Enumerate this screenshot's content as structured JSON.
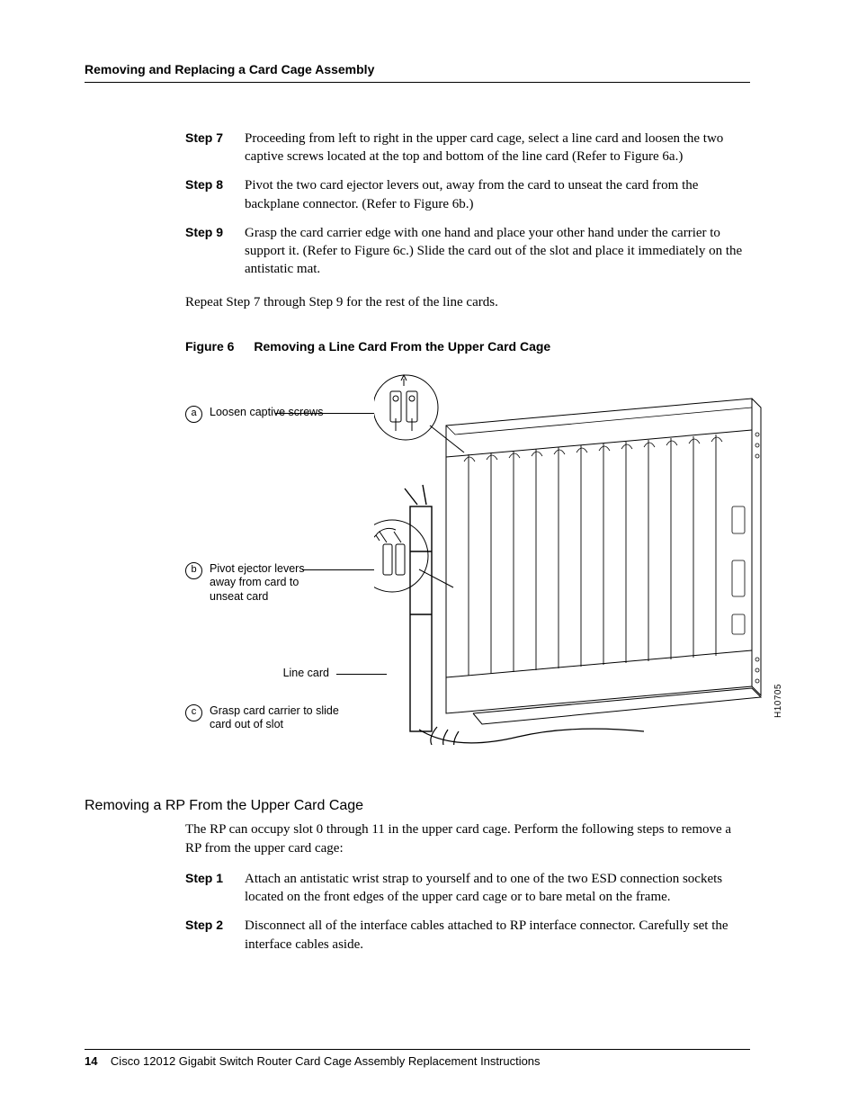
{
  "header": {
    "running_head": "Removing and Replacing a Card Cage Assembly"
  },
  "steps_a": [
    {
      "label": "Step 7",
      "text": "Proceeding from left to right in the upper card cage, select a line card and loosen the two captive screws located at the top and bottom of the line card (Refer to Figure 6a.)"
    },
    {
      "label": "Step 8",
      "text": "Pivot the two card ejector levers out, away from the card to unseat the card from the backplane connector. (Refer to Figure 6b.)"
    },
    {
      "label": "Step 9",
      "text": "Grasp the card carrier edge with one hand and place your other hand under the carrier to support it. (Refer to Figure 6c.) Slide the card out of the slot and place it immediately on the antistatic mat."
    }
  ],
  "repeat_line": "Repeat Step 7 through Step 9 for the rest of the line cards.",
  "figure": {
    "label": "Figure 6",
    "title": "Removing a Line Card From the Upper Card Cage",
    "callouts": {
      "a": {
        "letter": "a",
        "text": "Loosen captive screws"
      },
      "b": {
        "letter": "b",
        "text": "Pivot ejector levers away from card to unseat card"
      },
      "c": {
        "letter": "c",
        "text": "Grasp card carrier to slide card out of slot"
      }
    },
    "linecard_label": "Line card",
    "drawing_id": "H10705"
  },
  "section2": {
    "heading": "Removing a RP From the Upper Card Cage",
    "intro": "The RP can occupy slot 0 through 11 in the upper card cage. Perform the following steps to remove a RP from the upper card cage:",
    "steps": [
      {
        "label": "Step 1",
        "text": "Attach an antistatic wrist strap to yourself and to one of the two ESD connection sockets located on the front edges of the upper card cage or to bare metal on the frame."
      },
      {
        "label": "Step 2",
        "text": "Disconnect all of the interface cables attached to RP interface connector. Carefully set the interface cables aside."
      }
    ]
  },
  "footer": {
    "page_number": "14",
    "doc_title": "Cisco 12012 Gigabit Switch Router Card Cage Assembly Replacement Instructions"
  }
}
